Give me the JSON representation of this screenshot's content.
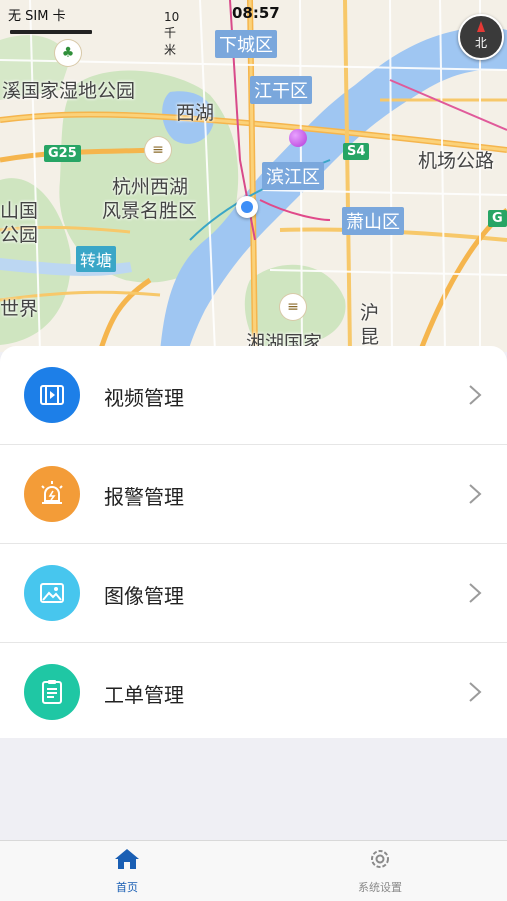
{
  "status": {
    "carrier": "无 SIM 卡",
    "time": "08:57"
  },
  "map": {
    "scale_label": "10 千米",
    "compass_label": "北",
    "labels": {
      "wetland": "溪国家湿地公园",
      "west_lake": "西湖",
      "scenic_1": "杭州西湖",
      "scenic_2": "风景名胜区",
      "shan": "山国",
      "gongyuan": "公园",
      "world": "世界",
      "xianghu": "湘湖国家",
      "hu": "沪",
      "kun": "昆",
      "airport_road": "机场公路"
    },
    "districts": {
      "xiacheng": "下城区",
      "jianggan": "江干区",
      "binjiang": "滨江区",
      "xiaoshan": "萧山区"
    },
    "roads": {
      "g25": "G25",
      "s4": "S4",
      "g_right": "G"
    },
    "metro": {
      "zhuantang": "转塘"
    }
  },
  "menu": {
    "items": [
      {
        "label": "视频管理",
        "icon": "video-icon",
        "color": "#1d7fe8"
      },
      {
        "label": "报警管理",
        "icon": "alarm-icon",
        "color": "#f39c38"
      },
      {
        "label": "图像管理",
        "icon": "image-icon",
        "color": "#47c6ee"
      },
      {
        "label": "工单管理",
        "icon": "clipboard-icon",
        "color": "#1fc7a4"
      }
    ]
  },
  "tabbar": {
    "home": {
      "label": "首页",
      "icon": "home-icon",
      "color": "#1a5fb4"
    },
    "settings": {
      "label": "系统设置",
      "icon": "gear-icon",
      "color": "#8a8a8a"
    }
  }
}
